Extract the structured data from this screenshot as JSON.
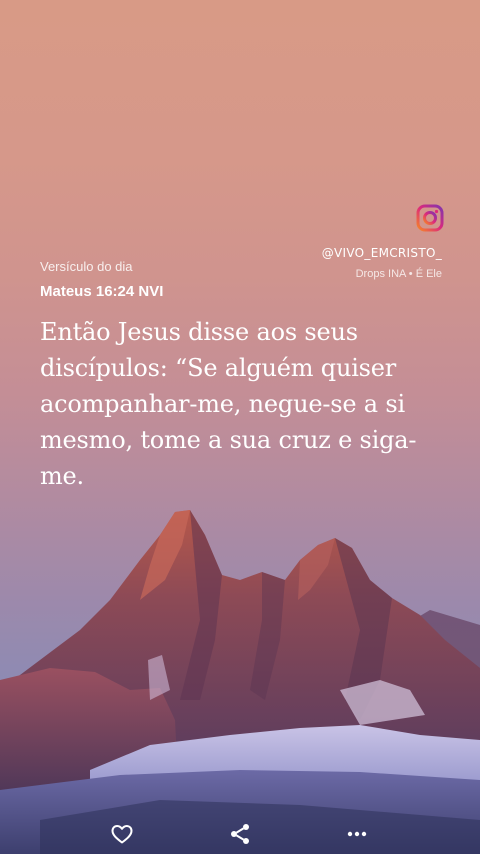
{
  "social": {
    "icon": "instagram-icon",
    "handle": "@VIVO_EMCRISTO_",
    "subline": "Drops INA • É Ele"
  },
  "verse": {
    "label": "Versículo do dia",
    "reference": "Mateus 16:24 NVI",
    "text": "Então Jesus disse aos seus discípulos: “Se alguém quiser acompanhar-me, negue-se a si mesmo, tome a sua cruz e siga-me."
  },
  "actions": [
    {
      "icon": "heart-icon"
    },
    {
      "icon": "share-icon"
    },
    {
      "icon": "more-icon"
    }
  ],
  "colors": {
    "sky_top": "#d89a86",
    "sky_bottom": "#7b86b4",
    "instagram_gradient": [
      "#f58529",
      "#dd2a7b",
      "#8134af"
    ]
  }
}
